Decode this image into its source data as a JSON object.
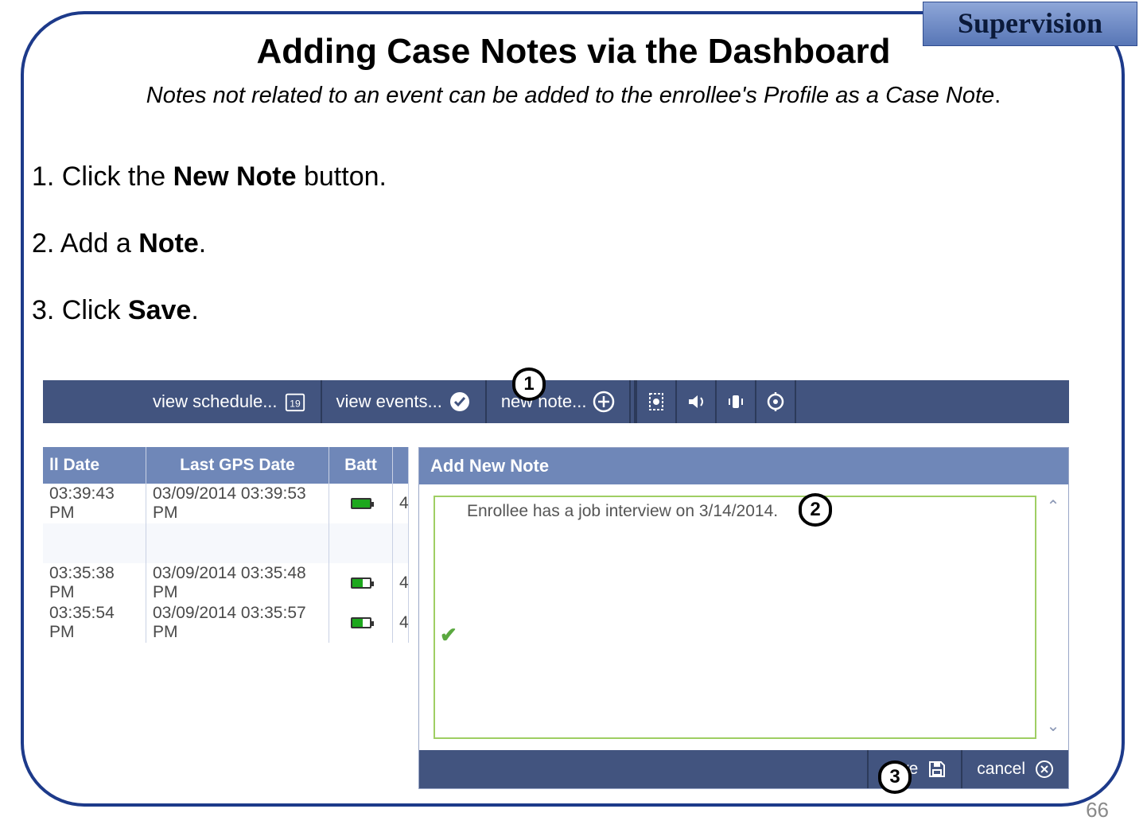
{
  "tab": "Supervision",
  "title": "Adding Case Notes via the Dashboard",
  "subtitle_italic": "Notes not related to an event can be added to the enrollee's Profile as a Case Note",
  "subtitle_period": ".",
  "page_number": "66",
  "steps": {
    "s1_pre": "1.  Click the ",
    "s1_bold": "New Note",
    "s1_post": " button.",
    "s2_pre": "2.  Add a ",
    "s2_bold": "Note",
    "s2_post": ".",
    "s3_pre": "3.  Click ",
    "s3_bold": "Save",
    "s3_post": "."
  },
  "toolbar": {
    "view_schedule": "view schedule...",
    "cal_badge": "19",
    "view_events": "view events...",
    "new_note": "new note..."
  },
  "grid": {
    "headers": {
      "date": "ll Date",
      "gps": "Last GPS Date",
      "batt": "Batt"
    },
    "rows": [
      {
        "date": "03:39:43 PM",
        "gps": "03/09/2014 03:39:53 PM",
        "batt": "full",
        "x": "4"
      },
      {
        "blank": true
      },
      {
        "date": "03:35:38 PM",
        "gps": "03/09/2014 03:35:48 PM",
        "batt": "low",
        "x": "4"
      },
      {
        "date": "03:35:54 PM",
        "gps": "03/09/2014 03:35:57 PM",
        "batt": "low",
        "x": "4"
      }
    ]
  },
  "dialog": {
    "title": "Add New Note",
    "note_text": "Enrollee has a job interview on 3/14/2014.",
    "save": "save",
    "cancel": "cancel"
  },
  "callouts": {
    "c1": "1",
    "c2": "2",
    "c3": "3"
  }
}
